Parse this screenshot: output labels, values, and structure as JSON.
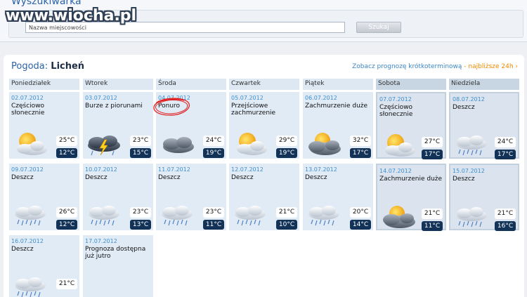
{
  "search": {
    "title": "Wyszukiwarka",
    "placeholder": "Nazwa miejscowości",
    "button": "Szukaj"
  },
  "watermark": "www.wiocha.pl",
  "weather": {
    "label": "Pogoda:",
    "city": "Licheń",
    "link_blue": "Zobacz prognozę krótkoterminową",
    "link_orange": "najbliższe 24h",
    "days": [
      "Poniedziałek",
      "Wtorek",
      "Środa",
      "Czwartek",
      "Piątek",
      "Sobota",
      "Niedziela"
    ],
    "cells": [
      {
        "date": "02.07.2012",
        "desc": "Częściowo słonecznie",
        "icon": "partly-sunny-icon",
        "tmax": "25°C",
        "tmin": "12°C"
      },
      {
        "date": "03.07.2012",
        "desc": "Burze z piorunami",
        "icon": "thunderstorm-icon",
        "tmax": "23°C",
        "tmin": "15°C"
      },
      {
        "date": "04.07.2012",
        "desc": "Ponuro",
        "icon": "overcast-icon",
        "tmax": "24°C",
        "tmin": "19°C"
      },
      {
        "date": "05.07.2012",
        "desc": "Przejściowe zachmurzenie",
        "icon": "partly-sunny-icon",
        "tmax": "29°C",
        "tmin": "19°C"
      },
      {
        "date": "06.07.2012",
        "desc": "Zachmurzenie duże",
        "icon": "cloudy-sun-icon",
        "tmax": "32°C",
        "tmin": "17°C"
      },
      {
        "date": "07.07.2012",
        "desc": "Częściowo słonecznie",
        "icon": "partly-sunny-icon",
        "tmax": "27°C",
        "tmin": "17°C"
      },
      {
        "date": "08.07.2012",
        "desc": "Deszcz",
        "icon": "rain-icon",
        "tmax": "24°C",
        "tmin": "17°C"
      },
      {
        "date": "09.07.2012",
        "desc": "Deszcz",
        "icon": "rain-icon",
        "tmax": "26°C",
        "tmin": "12°C"
      },
      {
        "date": "10.07.2012",
        "desc": "Deszcz",
        "icon": "rain-icon",
        "tmax": "23°C",
        "tmin": "13°C"
      },
      {
        "date": "11.07.2012",
        "desc": "Deszcz",
        "icon": "rain-icon",
        "tmax": "23°C",
        "tmin": "11°C"
      },
      {
        "date": "12.07.2012",
        "desc": "Deszcz",
        "icon": "rain-icon",
        "tmax": "21°C",
        "tmin": "10°C"
      },
      {
        "date": "13.07.2012",
        "desc": "Deszcz",
        "icon": "rain-icon",
        "tmax": "20°C",
        "tmin": "14°C"
      },
      {
        "date": "14.07.2012",
        "desc": "Zachmurzenie duże",
        "icon": "cloudy-sun-icon",
        "tmax": "21°C",
        "tmin": "11°C"
      },
      {
        "date": "15.07.2012",
        "desc": "Deszcz",
        "icon": "rain-icon",
        "tmax": "21°C",
        "tmin": "16°C"
      },
      {
        "date": "16.07.2012",
        "desc": "Deszcz",
        "icon": "rain-icon",
        "tmax": "21°C"
      },
      {
        "date": "17.07.2012",
        "desc": "Prognoza dostępna już jutro"
      }
    ]
  },
  "colors": {
    "accent_blue": "#2b63a8",
    "date_blue": "#3d8fcf",
    "link_orange": "#f08a00",
    "tmin_bg": "#123258",
    "annotation_red": "#e02020"
  }
}
